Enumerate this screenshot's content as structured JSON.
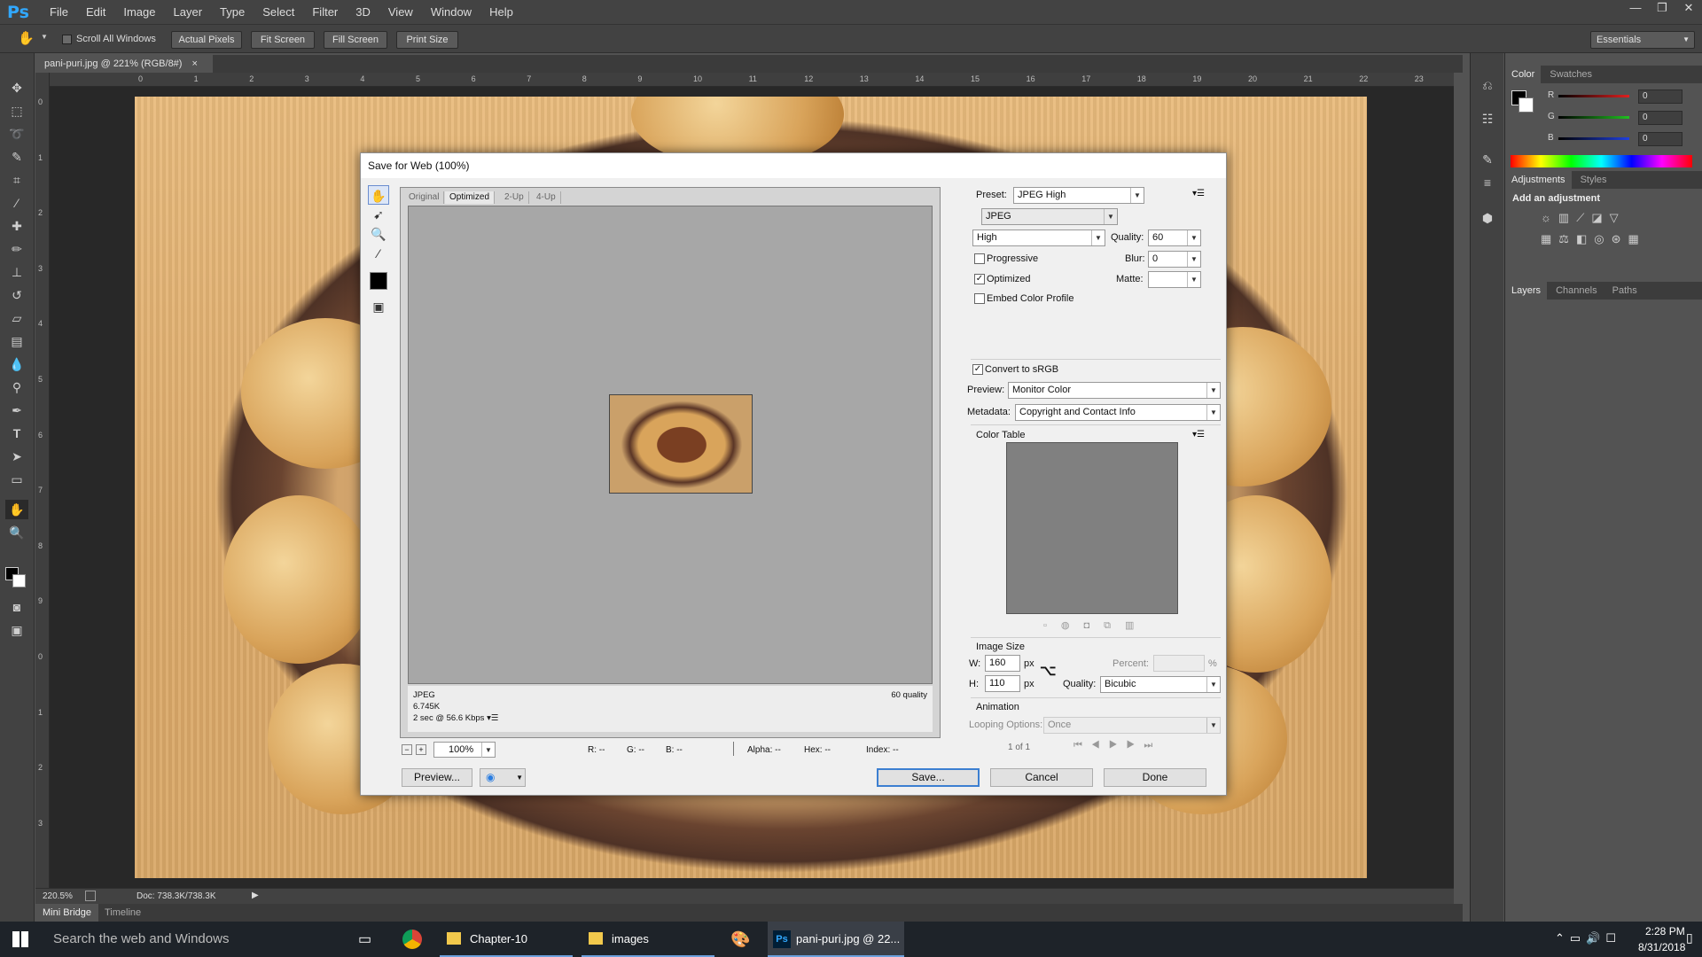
{
  "app": {
    "logo": "Ps"
  },
  "menu": [
    "File",
    "Edit",
    "Image",
    "Layer",
    "Type",
    "Select",
    "Filter",
    "3D",
    "View",
    "Window",
    "Help"
  ],
  "window_controls": {
    "minimize": "—",
    "restore": "❐",
    "close": "✕"
  },
  "options_bar": {
    "scroll_all_windows": "Scroll All Windows",
    "actual_pixels": "Actual Pixels",
    "fit_screen": "Fit Screen",
    "fill_screen": "Fill Screen",
    "print_size": "Print Size",
    "workspace": "Essentials"
  },
  "document": {
    "tab_title": "pani-puri.jpg @ 221% (RGB/8#)",
    "tab_close": "×",
    "ruler_h": [
      "0",
      "1",
      "2",
      "3",
      "4",
      "5",
      "6",
      "7",
      "8",
      "9",
      "10",
      "11",
      "12",
      "13",
      "14",
      "15",
      "16",
      "17",
      "18",
      "19",
      "20",
      "21",
      "22",
      "23"
    ],
    "ruler_v": [
      "0",
      "1",
      "2",
      "3",
      "4",
      "5",
      "6",
      "7",
      "8",
      "9",
      "0",
      "1",
      "2",
      "3"
    ],
    "zoom": "220.5%",
    "doc_size": "Doc: 738.3K/738.3K"
  },
  "bottom_tabs": [
    "Mini Bridge",
    "Timeline"
  ],
  "panels": {
    "color_tabs": [
      "Color",
      "Swatches"
    ],
    "channels": [
      {
        "name": "R",
        "value": "0",
        "color": "#e02020"
      },
      {
        "name": "G",
        "value": "0",
        "color": "#20c020"
      },
      {
        "name": "B",
        "value": "0",
        "color": "#2040e0"
      }
    ],
    "adjust_tabs": [
      "Adjustments",
      "Styles"
    ],
    "add_adjustment": "Add an adjustment",
    "layer_tabs": [
      "Layers",
      "Channels",
      "Paths"
    ]
  },
  "dialog": {
    "title": "Save for Web (100%)",
    "preview_tabs": [
      "Original",
      "Optimized",
      "2-Up",
      "4-Up"
    ],
    "info": {
      "format": "JPEG",
      "size": "6.745K",
      "time": "2 sec @ 56.6 Kbps",
      "quality": "60 quality"
    },
    "zoom": "100%",
    "readout": {
      "r": "R: --",
      "g": "G: --",
      "b": "B: --",
      "alpha": "Alpha: --",
      "hex": "Hex: --",
      "index": "Index: --"
    },
    "preview_button": "Preview...",
    "preset_label": "Preset:",
    "preset": "JPEG High",
    "format": "JPEG",
    "compression": "High",
    "quality_label": "Quality:",
    "quality": "60",
    "blur_label": "Blur:",
    "blur": "0",
    "matte_label": "Matte:",
    "matte": "",
    "progressive": {
      "label": "Progressive",
      "checked": false
    },
    "optimized": {
      "label": "Optimized",
      "checked": true
    },
    "embed_profile": {
      "label": "Embed Color Profile",
      "checked": false
    },
    "convert_srgb": {
      "label": "Convert to sRGB",
      "checked": true
    },
    "preview_label": "Preview:",
    "preview_value": "Monitor Color",
    "metadata_label": "Metadata:",
    "metadata_value": "Copyright and Contact Info",
    "color_table": "Color Table",
    "image_size": "Image Size",
    "w_label": "W:",
    "width": "160",
    "h_label": "H:",
    "height": "110",
    "px": "px",
    "percent_label": "Percent:",
    "percent": "",
    "percent_sign": "%",
    "resample_label": "Quality:",
    "resample": "Bicubic",
    "animation": "Animation",
    "looping_label": "Looping Options:",
    "looping": "Once",
    "frame_counter": "1 of 1",
    "save": "Save...",
    "cancel": "Cancel",
    "done": "Done"
  },
  "taskbar": {
    "search": "Search the web and Windows",
    "apps": [
      "Chapter-10",
      "images",
      "pani-puri.jpg @ 22..."
    ],
    "time": "2:28 PM",
    "date": "8/31/2018"
  }
}
